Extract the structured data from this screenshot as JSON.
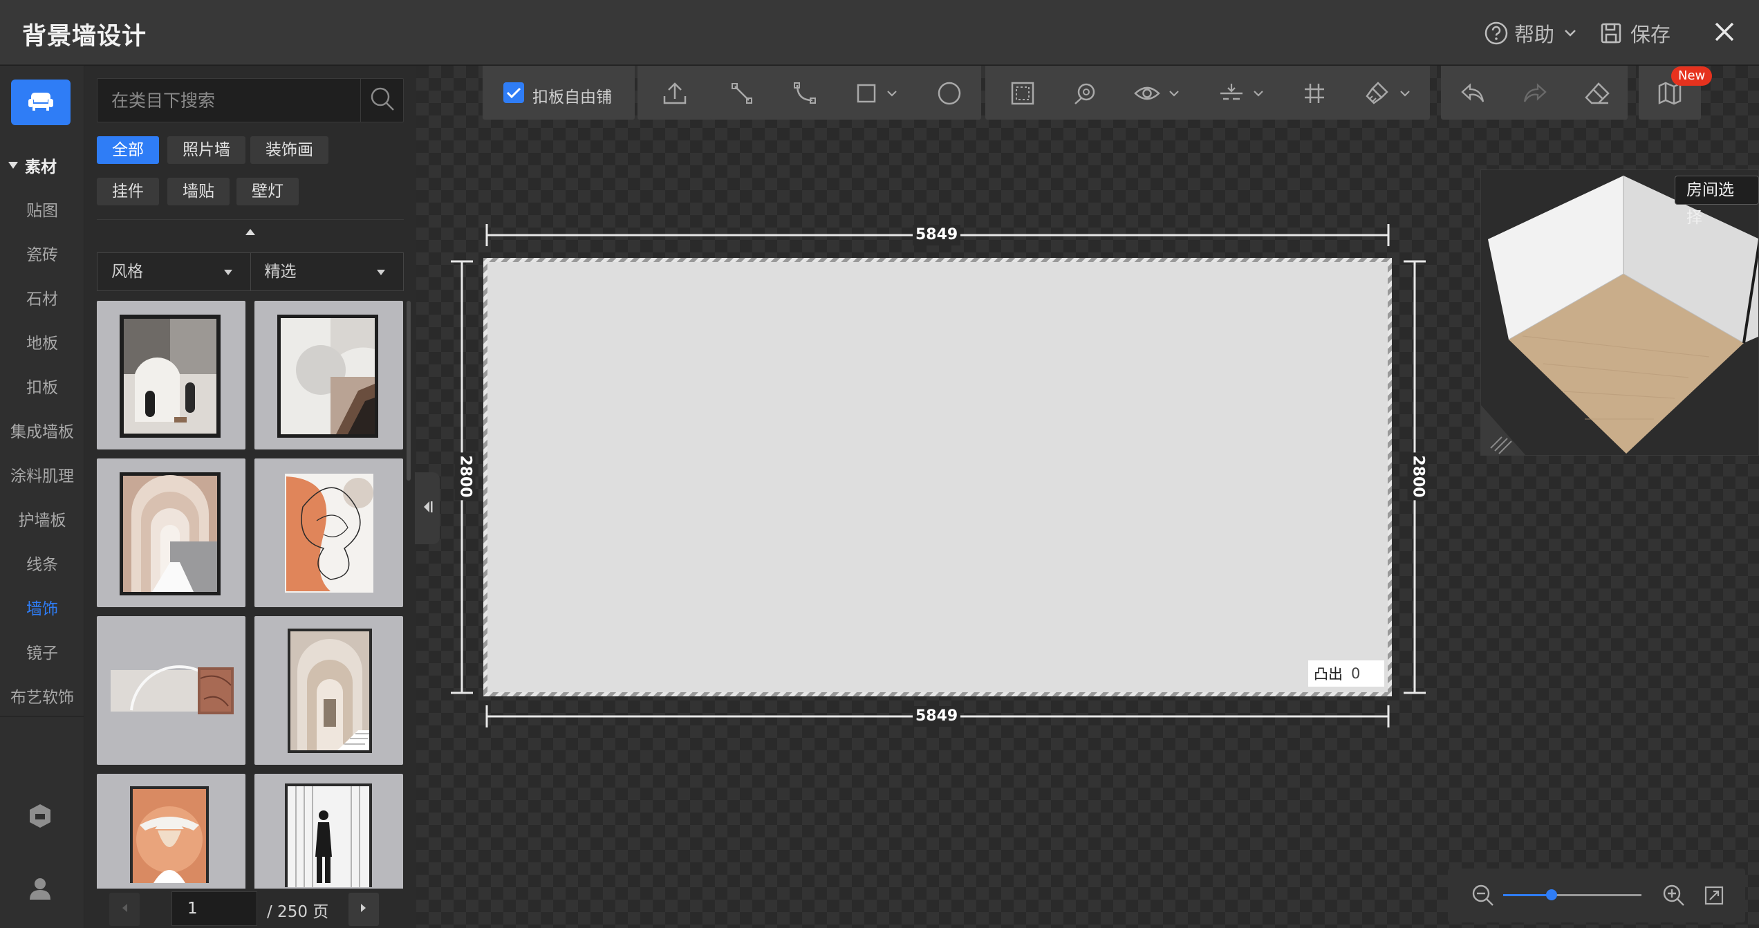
{
  "window": {
    "title": "背景墙设计"
  },
  "header": {
    "help_label": "帮助",
    "save_label": "保存"
  },
  "rail": {
    "category_head": "素材",
    "items": [
      {
        "label": "贴图"
      },
      {
        "label": "瓷砖"
      },
      {
        "label": "石材"
      },
      {
        "label": "地板"
      },
      {
        "label": "扣板"
      },
      {
        "label": "集成墙板"
      },
      {
        "label": "涂料肌理"
      },
      {
        "label": "护墙板"
      },
      {
        "label": "线条"
      },
      {
        "label": "墙饰",
        "active": true
      },
      {
        "label": "镜子"
      },
      {
        "label": "布艺软饰"
      }
    ]
  },
  "search": {
    "placeholder": "在类目下搜索"
  },
  "chips": [
    {
      "label": "全部",
      "active": true
    },
    {
      "label": "照片墙"
    },
    {
      "label": "装饰画"
    },
    {
      "label": "挂件"
    },
    {
      "label": "墙贴"
    },
    {
      "label": "壁灯"
    }
  ],
  "filters": {
    "style_label": "风格",
    "sort_label": "精选"
  },
  "pager": {
    "current": "1",
    "total_label": "/ 250 页"
  },
  "toolbar": {
    "free_tile_label": "扣板自由铺",
    "new_badge": "New"
  },
  "canvas": {
    "width_top": "5849",
    "width_bottom": "5849",
    "height_left": "2800",
    "height_right": "2800",
    "protrude_label": "凸出",
    "protrude_value": "0"
  },
  "mini_view": {
    "room_select_label": "房间选择"
  },
  "zoom": {
    "level": 0.35
  },
  "colors": {
    "accent": "#2f7df6",
    "badge": "#e6321e"
  }
}
